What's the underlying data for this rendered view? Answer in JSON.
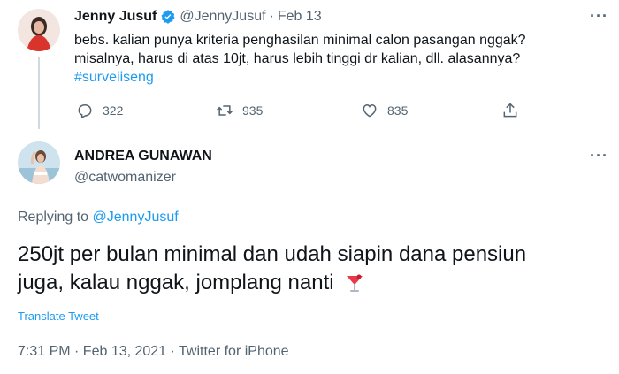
{
  "parent_tweet": {
    "display_name": "Jenny Jusuf",
    "handle": "@JennyJusuf",
    "separator": "·",
    "date": "Feb 13",
    "text_lines": [
      "bebs. kalian punya kriteria penghasilan minimal calon pasangan nggak?",
      "misalnya, harus di atas 10jt, harus lebih tinggi dr kalian, dll. alasannya?"
    ],
    "hashtag": "#surveiiseng",
    "replies": "322",
    "retweets": "935",
    "likes": "835",
    "more": "···"
  },
  "reply_tweet": {
    "display_name": "ANDREA GUNAWAN",
    "handle": "@catwomanizer",
    "more": "···",
    "replying_to_label": "Replying to",
    "replying_to_handle": "@JennyJusuf",
    "text_line1": "250jt per bulan minimal dan udah siapin dana pensiun",
    "text_line2": "juga, kalau nggak, jomplang nanti",
    "translate_label": "Translate Tweet",
    "timestamp": "7:31 PM · Feb 13, 2021 · Twitter for iPhone"
  },
  "colors": {
    "accent": "#1d9bf0",
    "muted": "#536471",
    "text": "#0f1419"
  },
  "icons": [
    "verified-badge-icon",
    "reply-icon",
    "retweet-icon",
    "like-icon",
    "share-icon",
    "more-icon",
    "cocktail-emoji-icon"
  ]
}
